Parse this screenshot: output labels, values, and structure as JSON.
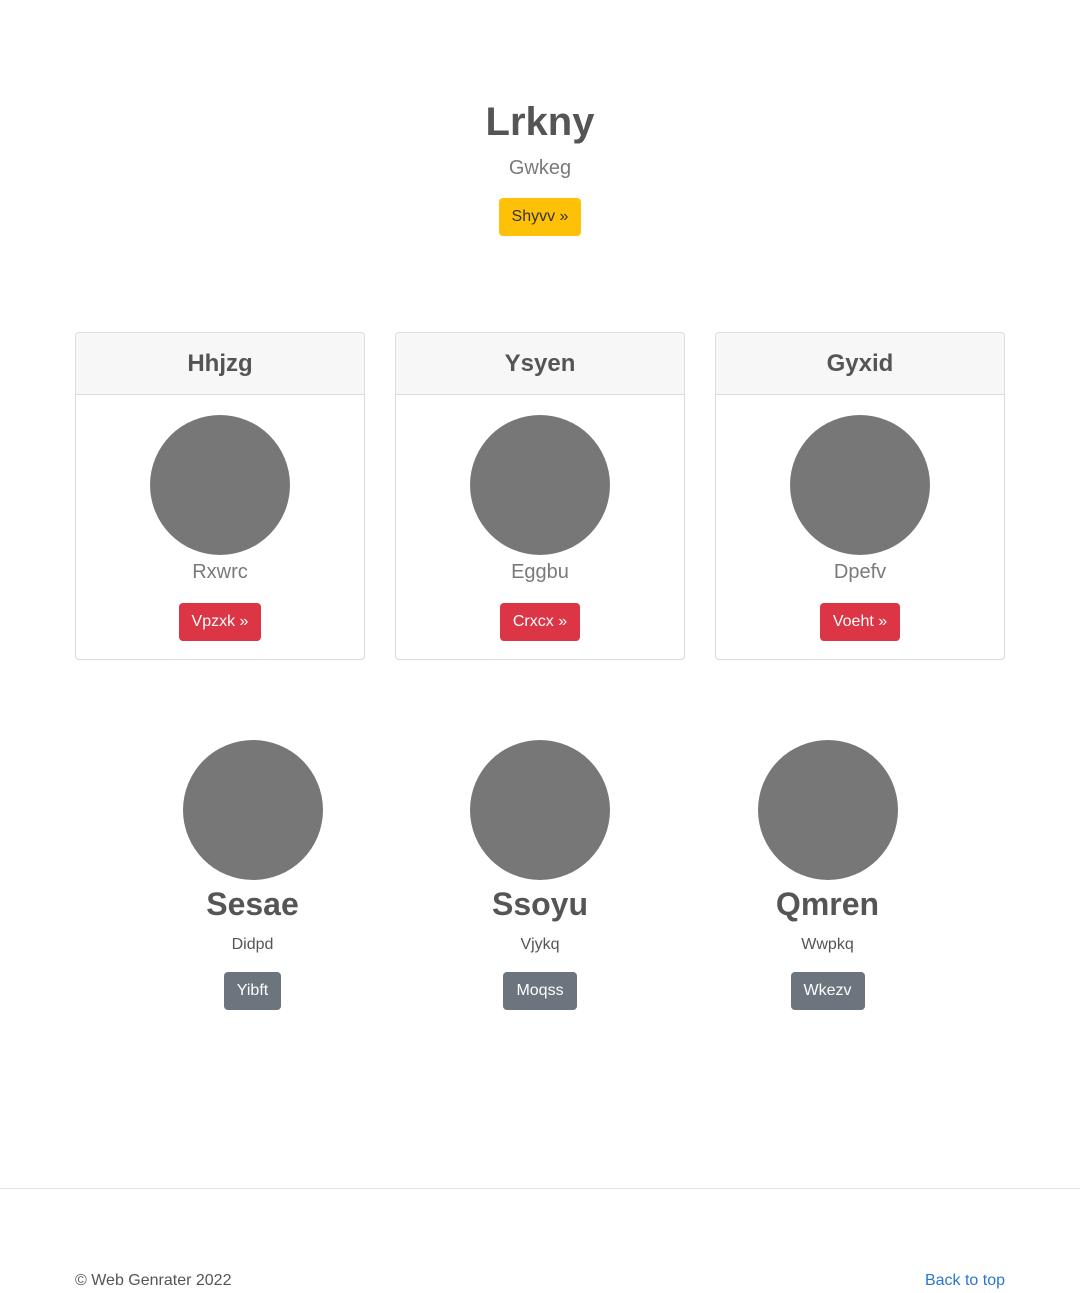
{
  "hero": {
    "title": "Lrkny",
    "subtitle": "Gwkeg",
    "button_label": "Shyvv »"
  },
  "cards": [
    {
      "header": "Hhjzg",
      "text": "Rxwrc",
      "button_label": "Vpzxk »"
    },
    {
      "header": "Ysyen",
      "text": "Eggbu",
      "button_label": "Crxcx »"
    },
    {
      "header": "Gyxid",
      "text": "Dpefv",
      "button_label": "Voeht »"
    }
  ],
  "features": [
    {
      "title": "Sesae",
      "text": "Didpd",
      "button_label": "Yibft"
    },
    {
      "title": "Ssoyu",
      "text": "Vjykq",
      "button_label": "Moqss"
    },
    {
      "title": "Qmren",
      "text": "Wwpkq",
      "button_label": "Wkezv"
    }
  ],
  "footer": {
    "copyright": "© Web Genrater 2022",
    "back_to_top": "Back to top"
  },
  "colors": {
    "warning": "#ffc107",
    "danger": "#dc3545",
    "secondary": "#6c757d",
    "placeholder_circle": "#777777",
    "link": "#2a76d2"
  }
}
